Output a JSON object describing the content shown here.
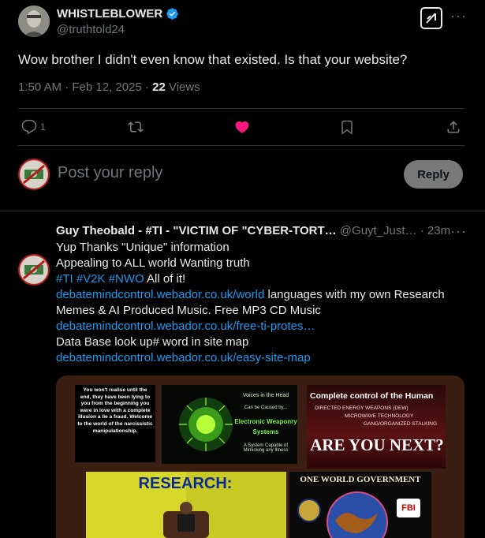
{
  "post": {
    "author_name": "WHISTLEBLOWER",
    "author_handle": "@truthtold24",
    "text": "Wow brother I didn't even know that existed. Is that your website?",
    "time": "1:50 AM · Feb 12, 2025 · ",
    "views_count": "22",
    "views_label": " Views",
    "reply_count": "1"
  },
  "composer": {
    "placeholder": "Post your reply",
    "reply_button": "Reply"
  },
  "reply": {
    "author_name": "Guy Theobald - #TI - \"VICTIM OF \"CYBER-TORT…",
    "author_handle": "@Guyt_Just…",
    "time": "· 23m",
    "line1": "Yup Thanks \"Unique\" information",
    "line2": "Appealing to ALL world Wanting truth",
    "hashtags": "#TI #V2K #NWO",
    "line3_rest": " All of it!",
    "link1": "debatemindcontrol.webador.co.uk/world",
    "link1_rest": " languages with my own Research",
    "line4": "Memes & AI Produced Music. Free MP3 CD Music",
    "link2": "debatemindcontrol.webador.co.uk/free-ti-protes…",
    "line5": "Data Base look up# word in site map",
    "link3": "debatemindcontrol.webador.co.uk/easy-site-map"
  },
  "meme": {
    "panel1": "You won't realise until the end, they have been lying to you from the beginning you were in love with a complete illusion a lie a fraud. Welcome to the world of the narcissistic manipulationship.",
    "panel2_title": "Voices in the Head",
    "panel2_sub": "Can be Caused by...",
    "panel2_main": "Electronic Weaponry Systems",
    "panel2_foot": "A System Capable of Mimicking any Illness",
    "panel3_title": "Complete control of the Human",
    "panel3_l1": "DIRECTED ENERGY WEAPONS (DEW)",
    "panel3_l2": "MICROWAVE TECHNOLOGY",
    "panel3_l3": "GANG/ORGANIZED STALKING",
    "panel3_big": "ARE YOU NEXT?",
    "panel4_title": "RESEARCH:",
    "panel5_title": "One World Government",
    "panel5_badge": "FBI"
  }
}
